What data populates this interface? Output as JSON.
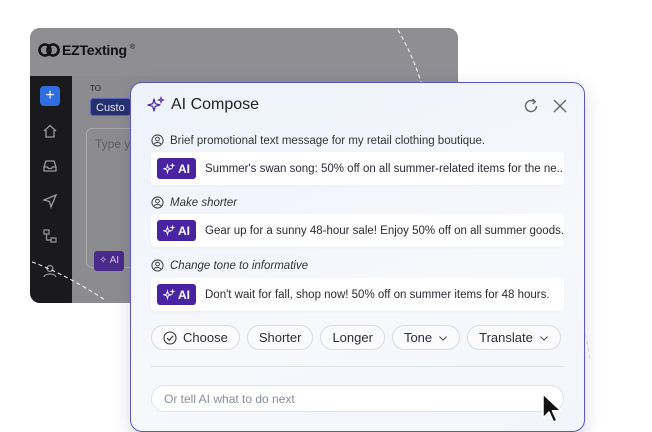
{
  "background_app": {
    "logo_text": "EZTexting",
    "logo_reg": "®",
    "to_label": "TO",
    "recipient_chip": "Custo",
    "message_placeholder": "Type y",
    "ai_button": "AI",
    "sidebar_icons": [
      "plus-icon",
      "home-icon",
      "inbox-icon",
      "send-icon",
      "org-chart-icon",
      "contacts-icon"
    ],
    "accent": "#2f6de1"
  },
  "dialog": {
    "title": "AI Compose",
    "title_icon": "sparkle-icon",
    "refresh_icon": "refresh-icon",
    "close_icon": "close-icon",
    "border_color": "#5f55c0"
  },
  "conversation": [
    {
      "prompt": "Brief promotional text message for my retail clothing boutique.",
      "badge": "AI",
      "response": "Summer's swan song: 50% off on all summer-related items for the ne..."
    },
    {
      "prompt": "Make shorter",
      "badge": "AI",
      "response": "Gear up for a sunny 48-hour sale! Enjoy 50% off on all summer goods."
    },
    {
      "prompt": "Change tone to informative",
      "badge": "AI",
      "response": "Don't wait for fall, shop now! 50% off on summer items for 48 hours."
    }
  ],
  "actions": {
    "choose": "Choose",
    "shorter": "Shorter",
    "longer": "Longer",
    "tone": "Tone",
    "translate": "Translate"
  },
  "input": {
    "placeholder": "Or tell AI what to do next",
    "value": ""
  },
  "colors": {
    "ai_badge": "#4a23a3"
  }
}
